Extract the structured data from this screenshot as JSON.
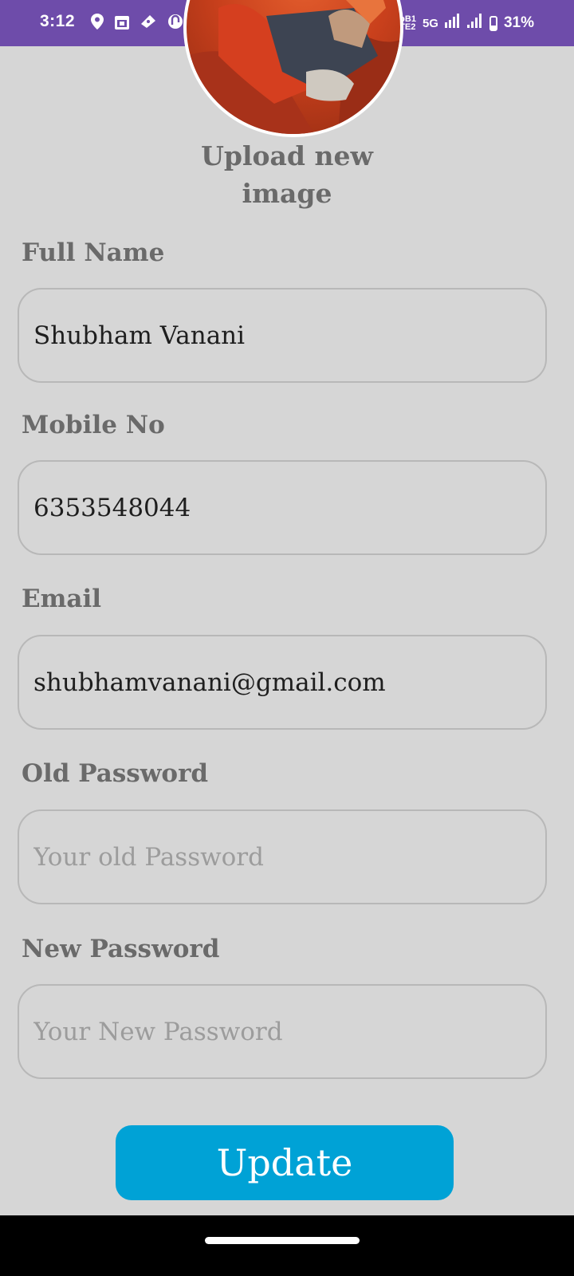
{
  "status_bar": {
    "time": "3:12",
    "network_top": "VoB1",
    "network_bottom": "LTE2",
    "network_type": "5G",
    "battery": "31%",
    "battery_level": 0.31,
    "left_icons": [
      "location-pin-icon",
      "calendar-icon",
      "ticket-icon",
      "app-notification-icon",
      "dot-icon"
    ],
    "right_icons": [
      "notifications-off-icon",
      "signal-icon",
      "signal-icon",
      "battery-icon"
    ]
  },
  "profile": {
    "upload_label": "Upload new image"
  },
  "form": {
    "full_name": {
      "label": "Full Name",
      "value": "Shubham Vanani",
      "placeholder": ""
    },
    "mobile": {
      "label": "Mobile No",
      "value": "6353548044",
      "placeholder": ""
    },
    "email": {
      "label": "Email",
      "value": "shubhamvanani@gmail.com",
      "placeholder": ""
    },
    "old_password": {
      "label": "Old Password",
      "value": "",
      "placeholder": "Your old Password"
    },
    "new_password": {
      "label": "New Password",
      "value": "",
      "placeholder": "Your New Password"
    },
    "submit_label": "Update"
  },
  "colors": {
    "status_bar": "#6e4caa",
    "background": "#d6d6d6",
    "button": "#00a2d6",
    "label": "#6a6a6a"
  }
}
